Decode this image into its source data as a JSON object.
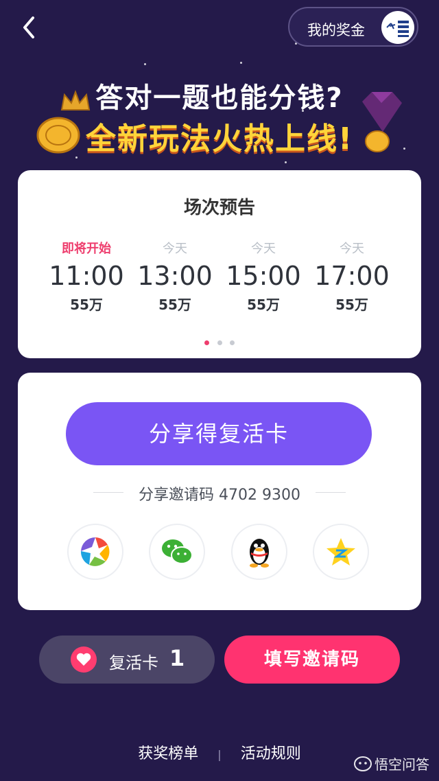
{
  "header": {
    "back_icon": "chevron-left-icon",
    "my_bonus_label": "我的奖金",
    "avatar_icon": "avatar-logo-icon"
  },
  "banner": {
    "line1": "答对一题也能分钱?",
    "line2": "全新玩法火热上线!"
  },
  "schedule": {
    "title": "场次预告",
    "slots": [
      {
        "status": "即将开始",
        "time": "11:00",
        "prize": "55万",
        "active": true
      },
      {
        "status": "今天",
        "time": "13:00",
        "prize": "55万",
        "active": false
      },
      {
        "status": "今天",
        "time": "15:00",
        "prize": "55万",
        "active": false
      },
      {
        "status": "今天",
        "time": "17:00",
        "prize": "55万",
        "active": false
      }
    ],
    "pager": {
      "pages": 3,
      "current": 1
    }
  },
  "share": {
    "button_label": "分享得复活卡",
    "invite_label": "分享邀请码 4702 9300",
    "platforms": [
      {
        "name": "moments",
        "icon": "moments-camera-icon"
      },
      {
        "name": "wechat",
        "icon": "wechat-icon"
      },
      {
        "name": "qq",
        "icon": "qq-penguin-icon"
      },
      {
        "name": "qzone",
        "icon": "qzone-star-icon"
      }
    ]
  },
  "actions": {
    "revive_label": "复活卡",
    "revive_count": "1",
    "invite_button": "填写邀请码"
  },
  "footer": {
    "leaderboard": "获奖榜单",
    "rules": "活动规则",
    "watermark": "悟空问答"
  },
  "colors": {
    "background": "#241a4a",
    "share_button": "#7a55f4",
    "invite_button": "#ff3370",
    "active_status": "#ee3e6e"
  }
}
